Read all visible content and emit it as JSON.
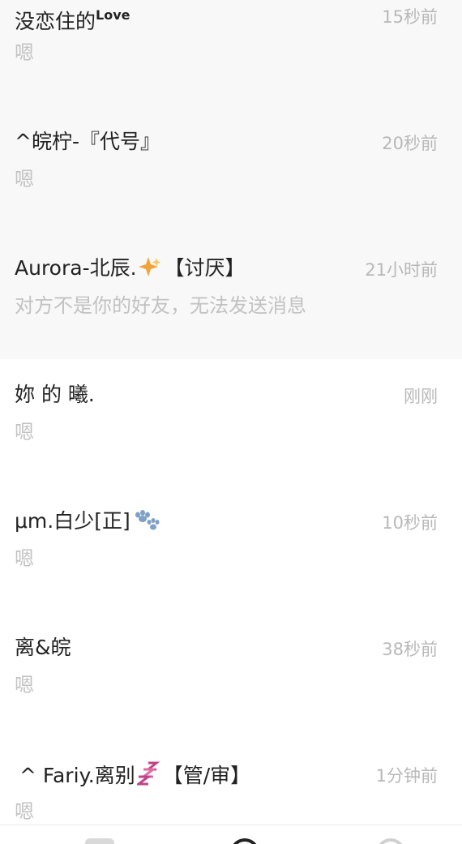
{
  "conversations": [
    {
      "name": "没恋住的",
      "name_sup": "Love",
      "time": "15秒前",
      "message": "嗯",
      "pinned": true
    },
    {
      "name": "^皖柠-『代号』",
      "time": "20秒前",
      "message": "嗯",
      "pinned": true
    },
    {
      "name": "Aurora-北辰.",
      "name_tag": "【讨厌】",
      "time": "21小时前",
      "message": "对方不是你的好友，无法发送消息",
      "pinned": true,
      "emoji": "sparkle-icon"
    },
    {
      "name": "妳 的 曦.",
      "time": "刚刚",
      "message": "嗯",
      "pinned": false
    },
    {
      "name": "μm.白少[正]",
      "time": "10秒前",
      "message": "嗯",
      "pinned": false,
      "emoji": "paw-icon"
    },
    {
      "name": "离&皖",
      "time": "38秒前",
      "message": "嗯",
      "pinned": false
    },
    {
      "name": "^ Fariy.离别",
      "name_tag": "【管/审】",
      "time": "1分钟前",
      "message": "嗯",
      "pinned": false,
      "emoji": "zzz-icon"
    }
  ],
  "colors": {
    "pinned_background": "#f8f8f8",
    "name_text": "#222222",
    "time_text": "#b8b8b8",
    "message_text": "#c2c2c2"
  }
}
